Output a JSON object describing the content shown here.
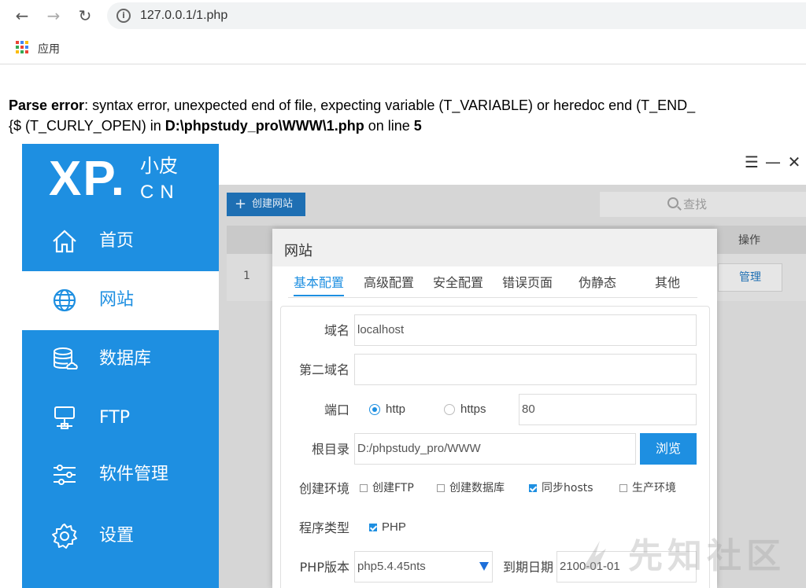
{
  "browser": {
    "url": "127.0.0.1/1.php",
    "bookmark_apps_label": "应用"
  },
  "error": {
    "prefix": "Parse error",
    "message": ": syntax error, unexpected end of file, expecting variable (T_VARIABLE) or heredoc end (T_END_",
    "line2_start": "{$ (T_CURLY_OPEN) in ",
    "path": "D:\\phpstudy_pro\\WWW\\1.php",
    "on_line": " on line ",
    "line_no": "5"
  },
  "app": {
    "logo": {
      "main": "XP.",
      "small_top": "小皮",
      "small_bottom": "CN"
    },
    "menu": [
      {
        "label": "首页",
        "icon": "home-icon"
      },
      {
        "label": "网站",
        "icon": "globe-icon",
        "active": true
      },
      {
        "label": "数据库",
        "icon": "database-icon"
      },
      {
        "label": "FTP",
        "icon": "ftp-server-icon"
      },
      {
        "label": "软件管理",
        "icon": "sliders-icon"
      },
      {
        "label": "设置",
        "icon": "gear-icon"
      }
    ],
    "toolbar": {
      "create_label": "创建网站",
      "search_placeholder": "查找"
    },
    "table": {
      "header_op": "操作",
      "row_num": "1",
      "manage_label": "管理"
    },
    "dialog": {
      "title": "网站",
      "tabs": [
        "基本配置",
        "高级配置",
        "安全配置",
        "错误页面",
        "伪静态",
        "其他"
      ],
      "form": {
        "domain_label": "域名",
        "domain_value": "localhost",
        "second_domain_label": "第二域名",
        "second_domain_value": "",
        "port_label": "端口",
        "http_label": "http",
        "https_label": "https",
        "port_value": "80",
        "root_label": "根目录",
        "root_value": "D:/phpstudy_pro/WWW",
        "browse_label": "浏览",
        "env_label": "创建环境",
        "env_options": [
          {
            "label": "创建FTP",
            "checked": false
          },
          {
            "label": "创建数据库",
            "checked": false
          },
          {
            "label": "同步hosts",
            "checked": true
          },
          {
            "label": "生产环境",
            "checked": false
          }
        ],
        "program_type_label": "程序类型",
        "program_type_option": "PHP",
        "php_version_label": "PHP版本",
        "php_version_value": "php5.4.45nts",
        "expire_label": "到期日期",
        "expire_value": "2100-01-01"
      }
    }
  },
  "watermark": "先知社区",
  "colors": {
    "accent": "#1e8fe1",
    "sidebar": "#1e8fe1",
    "overlay": "#d6d6d6"
  }
}
